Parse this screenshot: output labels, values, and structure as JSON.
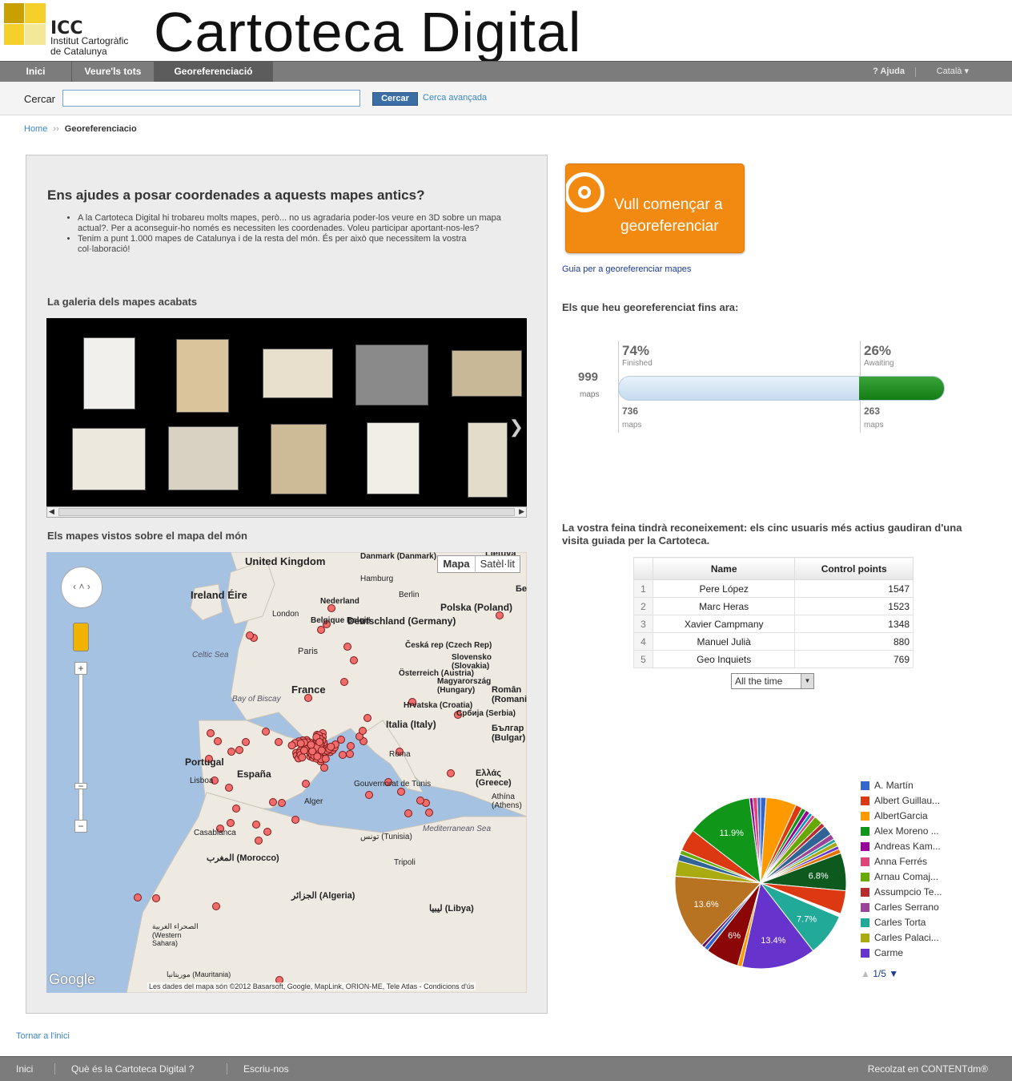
{
  "header": {
    "logo_abbr": "ICC",
    "logo_line1": "Institut Cartogràfic",
    "logo_line2": "de Catalunya",
    "site_title": "Cartoteca Digital"
  },
  "nav": {
    "tabs": [
      {
        "label": "Inici"
      },
      {
        "label": "Veure'ls tots"
      },
      {
        "label": "Georeferenciació"
      }
    ],
    "help": "? Ajuda",
    "language": "Català ▾"
  },
  "search": {
    "label": "Cercar",
    "value": "",
    "button": "Cercar",
    "advanced": "Cerca avançada"
  },
  "breadcrumb": {
    "home": "Home",
    "separator": "››",
    "current": "Georeferenciacio"
  },
  "left": {
    "title": "Ens ajudes a posar coordenades a aquests mapes antics?",
    "bullets": [
      "A la Cartoteca Digital hi trobareu molts mapes, però... no us agradaria poder-los veure en 3D sobre un mapa actual?. Per a aconseguir-ho només es necessiten les coordenades. Voleu participar aportant-nos-les?",
      "Tenim a punt 1.000 mapes de Catalunya i de la resta del món. És per això que necessitem la vostra col·laboració!"
    ],
    "gallery_heading": "La galeria dels mapes acabats",
    "map_heading": "Els mapes vistos sobre el mapa del món"
  },
  "map": {
    "type_map": "Mapa",
    "type_sat": "Satèl·lit",
    "logo": "Google",
    "copyright": "Les dades del mapa són ©2012 Basarsoft, Google, MapLink, ORION-ME, Tele Atlas - Condicions d'ús",
    "labels": [
      "United Kingdom",
      "Ireland Éire",
      "London",
      "Nederland",
      "Belgique België",
      "Deutschland (Germany)",
      "Polska (Poland)",
      "Česká rep (Czech Rep)",
      "Paris",
      "France",
      "Celtic Sea",
      "Bay of Biscay",
      "Österreich (Austria)",
      "Slovensko (Slovakia)",
      "Magyarország (Hungary)",
      "Hrvatska (Croatia)",
      "Italia (Italy)",
      "Portugal",
      "España",
      "Lisboa",
      "Alger",
      "Roma",
      "Ελλάς (Greece)",
      "Mediterranean Sea",
      "المغرب (Morocco)",
      "الجزائر (Algeria)",
      "ليبيا (Libya)",
      "تونس (Tunisia)",
      "Casablanca",
      "Tripoli",
      "Danmark (Danmark)",
      "Hamburg",
      "Berlin",
      "Slovenso",
      "Србија (Serbia)",
      "Român (Romani)",
      "Българ (Bulgar)",
      "Athína (Athens)",
      "Gouvernorat de Tunis",
      "Lietuva",
      "Бе",
      "الصحراء الغربية (Western Sahara)",
      "موريتانيا (Mauritania)"
    ]
  },
  "right": {
    "start_line1": "Vull començar a",
    "start_line2": "georeferenciar",
    "guide_link": "Guia per a georeferenciar mapes",
    "done_heading": "Els que heu georeferenciat fins ara:",
    "progress": {
      "total": "999",
      "total_unit": "maps",
      "finished_pct": "74%",
      "finished_label": "Finished",
      "awaiting_pct": "26%",
      "awaiting_label": "Awaiting",
      "finished_count": "736",
      "awaiting_count": "263",
      "unit": "maps",
      "fraction_finished": 0.74
    },
    "recognition": "La vostra feina tindrà reconeixement: els cinc usuaris més actius gaudiran d'una visita guiada per la Cartoteca.",
    "table": {
      "headers": [
        "Name",
        "Control points"
      ],
      "rows": [
        {
          "idx": "1",
          "name": "Pere López",
          "points": "1547"
        },
        {
          "idx": "2",
          "name": "Marc Heras",
          "points": "1523"
        },
        {
          "idx": "3",
          "name": "Xavier Campmany",
          "points": "1348"
        },
        {
          "idx": "4",
          "name": "Manuel Julià",
          "points": "880"
        },
        {
          "idx": "5",
          "name": "Geo Inquiets",
          "points": "769"
        }
      ]
    },
    "time_filter": "All the time",
    "legend": [
      {
        "name": "A. Martín",
        "color": "#3366cc"
      },
      {
        "name": "Albert Guillau...",
        "color": "#dc3912"
      },
      {
        "name": "AlbertGarcia",
        "color": "#ff9900"
      },
      {
        "name": "Alex Moreno ...",
        "color": "#109618"
      },
      {
        "name": "Andreas Kam...",
        "color": "#990099"
      },
      {
        "name": "Anna Ferrés",
        "color": "#dd4477"
      },
      {
        "name": "Arnau Comaj...",
        "color": "#66aa00"
      },
      {
        "name": "Assumpcio Te...",
        "color": "#b82e2e"
      },
      {
        "name": "Carles Serrano",
        "color": "#994499"
      },
      {
        "name": "Carles Torta",
        "color": "#22aa99"
      },
      {
        "name": "Carles Palaci...",
        "color": "#aaaa11"
      },
      {
        "name": "Carme",
        "color": "#6633cc"
      }
    ],
    "pager": "1/5"
  },
  "chart_data": {
    "type": "pie",
    "slice_labels": [
      "11.9%",
      "6.8%",
      "7.7%",
      "13.4%",
      "6%",
      "13.6%"
    ],
    "slices": [
      {
        "value": 1.0,
        "color": "#3366cc"
      },
      {
        "value": 5.5,
        "color": "#ff9900"
      },
      {
        "value": 1.2,
        "color": "#dc3912"
      },
      {
        "value": 0.8,
        "color": "#109618"
      },
      {
        "value": 0.8,
        "color": "#990099"
      },
      {
        "value": 0.6,
        "color": "#0099c6"
      },
      {
        "value": 0.6,
        "color": "#dd4477"
      },
      {
        "value": 1.6,
        "color": "#66aa00"
      },
      {
        "value": 0.8,
        "color": "#b82e2e"
      },
      {
        "value": 1.8,
        "color": "#316395"
      },
      {
        "value": 1.0,
        "color": "#994499"
      },
      {
        "value": 0.6,
        "color": "#22aa99"
      },
      {
        "value": 0.8,
        "color": "#aaaa11"
      },
      {
        "value": 0.6,
        "color": "#6633cc"
      },
      {
        "value": 0.8,
        "color": "#e67300"
      },
      {
        "value": 6.8,
        "color": "#0e5a1e"
      },
      {
        "value": 4.2,
        "color": "#dc3912"
      },
      {
        "value": 0.6,
        "color": "#ffffff"
      },
      {
        "value": 7.7,
        "color": "#22aa99"
      },
      {
        "value": 13.4,
        "color": "#6633cc"
      },
      {
        "value": 0.8,
        "color": "#ff9900"
      },
      {
        "value": 6.0,
        "color": "#8b0707"
      },
      {
        "value": 0.8,
        "color": "#3366cc"
      },
      {
        "value": 0.6,
        "color": "#651067"
      },
      {
        "value": 13.6,
        "color": "#b77322"
      },
      {
        "value": 2.8,
        "color": "#aaaa11"
      },
      {
        "value": 1.2,
        "color": "#316395"
      },
      {
        "value": 0.8,
        "color": "#66aa00"
      },
      {
        "value": 4.0,
        "color": "#dc3912"
      },
      {
        "value": 11.9,
        "color": "#109618"
      },
      {
        "value": 0.6,
        "color": "#990099"
      },
      {
        "value": 0.8,
        "color": "#dd4477"
      },
      {
        "value": 0.6,
        "color": "#3366cc"
      }
    ]
  },
  "footer": {
    "items": [
      "Inici",
      "Què és la Cartoteca Digital ?",
      "Escriu-nos"
    ],
    "right": "Recolzat en CONTENTdm®"
  }
}
